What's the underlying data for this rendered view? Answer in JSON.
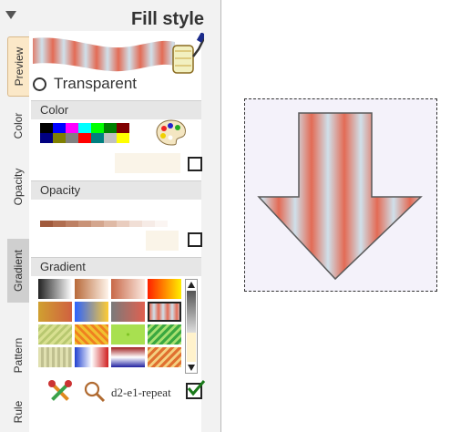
{
  "panel": {
    "title": "Fill style",
    "tabs": [
      "Preview",
      "Color",
      "Opacity",
      "Gradient",
      "Pattern",
      "Rule"
    ],
    "transparent_label": "Transparent",
    "sections": {
      "color": "Color",
      "opacity": "Opacity",
      "gradient": "Gradient"
    },
    "color_swatches": [
      "#000000",
      "#0000ff",
      "#ff00ff",
      "#00ffff",
      "#00ff00",
      "#008000",
      "#800000",
      "#ffffff",
      "#000080",
      "#808000",
      "#808080",
      "#ff0000",
      "#008080",
      "#c0c0c0",
      "#ffff00",
      "#ffffff"
    ],
    "opacity_swatches": [
      "#a05a3c",
      "#b06e50",
      "#bd8064",
      "#c99378",
      "#d4a68e",
      "#dfbaa6",
      "#e9cdbf",
      "#f1dfd6",
      "#f6ebe6",
      "#fbf5f2"
    ],
    "gradient_name": "d2-e1-repeat",
    "selected_gradient_index": 7
  },
  "icons": {
    "collapse": "triangle-down-icon",
    "roller": "paint-roller-icon",
    "palette": "palette-icon",
    "tools": "tools-icon",
    "zoom": "magnifier-icon",
    "apply": "checkmark-icon"
  }
}
